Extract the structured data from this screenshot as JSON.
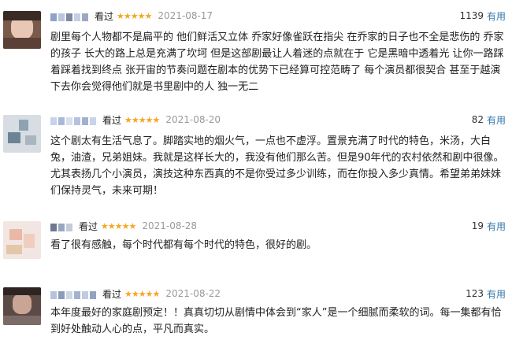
{
  "reviews": [
    {
      "status": "看过",
      "stars": "★★★★★",
      "date": "2021-08-17",
      "count": "1139",
      "useful_label": "有用",
      "text": "剧里每个人物都不是扁平的 他们鲜活又立体 乔家好像雀跃在指尖 在乔家的日子也不全是悲伤的 乔家的孩子 长大的路上总是充满了坎坷 但是这部剧最让人着迷的点就在于 它是黑暗中透着光 让你一路踩着踩着找到终点 张开宙的节奏问题在剧本的优势下已经算可控范畴了 每个演员都很契合 甚至于越演下去你会觉得他们就是书里剧中的人 独一无二"
    },
    {
      "status": "看过",
      "stars": "★★★★★",
      "date": "2021-08-20",
      "count": "82",
      "useful_label": "有用",
      "text": "这个剧太有生活气息了。脚踏实地的烟火气，一点也不虚浮。置景充满了时代的特色，米汤，大白兔，油渣，兄弟姐妹。我就是这样长大的，我没有他们那么苦。但是90年代的农村依然和剧中很像。尤其表扬几个小演员，演技这种东西真的不是你受过多少训练，而在你投入多少真情。希望弟弟妹妹们保持灵气，未来可期！"
    },
    {
      "status": "看过",
      "stars": "★★★★★",
      "date": "2021-08-28",
      "count": "19",
      "useful_label": "有用",
      "text": "看了很有感触，每个时代都有每个时代的特色，很好的剧。"
    },
    {
      "status": "看过",
      "stars": "★★★★★",
      "date": "2021-08-22",
      "count": "123",
      "useful_label": "有用",
      "text": "本年度最好的家庭剧预定！！真真切切从剧情中体会到“家人”是一个细腻而柔软的词。每一集都有恰到好处触动人心的点，平凡而真实。"
    }
  ]
}
